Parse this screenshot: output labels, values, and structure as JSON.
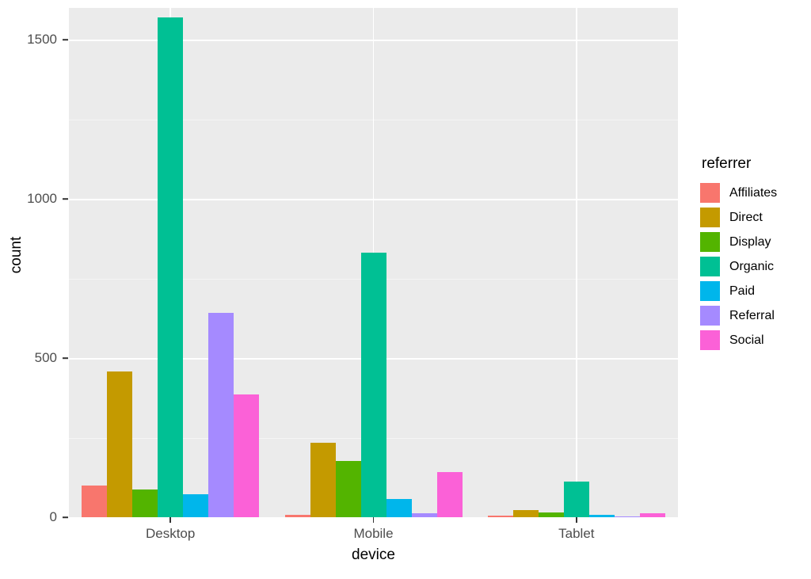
{
  "chart_data": {
    "type": "bar",
    "title": "",
    "xlabel": "device",
    "ylabel": "count",
    "categories": [
      "Desktop",
      "Mobile",
      "Tablet"
    ],
    "legend_title": "referrer",
    "legend_position": "right",
    "grid": true,
    "ylim": [
      0,
      1600
    ],
    "y_ticks": [
      0,
      500,
      1000,
      1500
    ],
    "y_tick_labels": [
      "0",
      "500",
      "1000",
      "1500"
    ],
    "y_minor_ticks": [
      250,
      750,
      1250
    ],
    "bar_mode": "grouped",
    "series": [
      {
        "name": "Affiliates",
        "color": "#F8766D",
        "values": [
          100,
          8,
          4
        ]
      },
      {
        "name": "Direct",
        "color": "#C49A00",
        "values": [
          459,
          234,
          22
        ]
      },
      {
        "name": "Display",
        "color": "#53B400",
        "values": [
          88,
          177,
          16
        ]
      },
      {
        "name": "Organic",
        "color": "#00C094",
        "values": [
          1570,
          830,
          112
        ]
      },
      {
        "name": "Paid",
        "color": "#00B6EB",
        "values": [
          72,
          57,
          7
        ]
      },
      {
        "name": "Referral",
        "color": "#A58AFF",
        "values": [
          643,
          13,
          2
        ]
      },
      {
        "name": "Social",
        "color": "#FB61D7",
        "values": [
          386,
          141,
          13
        ]
      }
    ]
  },
  "legend": {
    "title": "referrer",
    "items": [
      {
        "label": "Affiliates",
        "color": "#F8766D"
      },
      {
        "label": "Direct",
        "color": "#C49A00"
      },
      {
        "label": "Display",
        "color": "#53B400"
      },
      {
        "label": "Organic",
        "color": "#00C094"
      },
      {
        "label": "Paid",
        "color": "#00B6EB"
      },
      {
        "label": "Referral",
        "color": "#A58AFF"
      },
      {
        "label": "Social",
        "color": "#FB61D7"
      }
    ]
  },
  "axes": {
    "y_title": "count",
    "x_title": "device",
    "y_tick_labels": [
      "0",
      "500",
      "1000",
      "1500"
    ],
    "x_tick_labels": [
      "Desktop",
      "Mobile",
      "Tablet"
    ]
  },
  "theme": {
    "panel_background": "#ebebeb",
    "grid_major_color": "#ffffff",
    "grid_minor_color": "#f5f5f5",
    "text_color": "#4d4d4d",
    "title_color": "#000000",
    "plot_background": "#ffffff"
  }
}
